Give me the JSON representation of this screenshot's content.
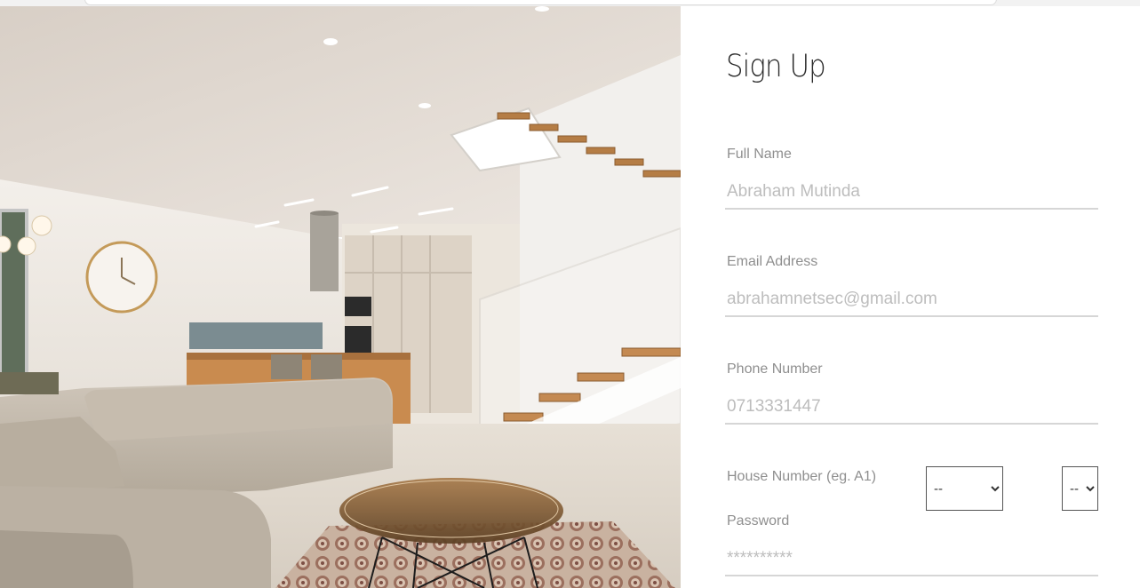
{
  "form": {
    "title": "Sign Up",
    "full_name": {
      "label": "Full Name",
      "placeholder": "Abraham Mutinda"
    },
    "email": {
      "label": "Email Address",
      "placeholder": "abrahamnetsec@gmail.com"
    },
    "phone": {
      "label": "Phone Number",
      "placeholder": "0713331447"
    },
    "house": {
      "label": "House Number (eg. A1)",
      "select_block": "--",
      "select_number": "--"
    },
    "password": {
      "label": "Password",
      "placeholder": "**********"
    }
  },
  "colors": {
    "label": "#8f8f8f",
    "placeholder": "#bdbdbd",
    "title": "#2a2a2a",
    "underline": "#d6d6d6"
  }
}
